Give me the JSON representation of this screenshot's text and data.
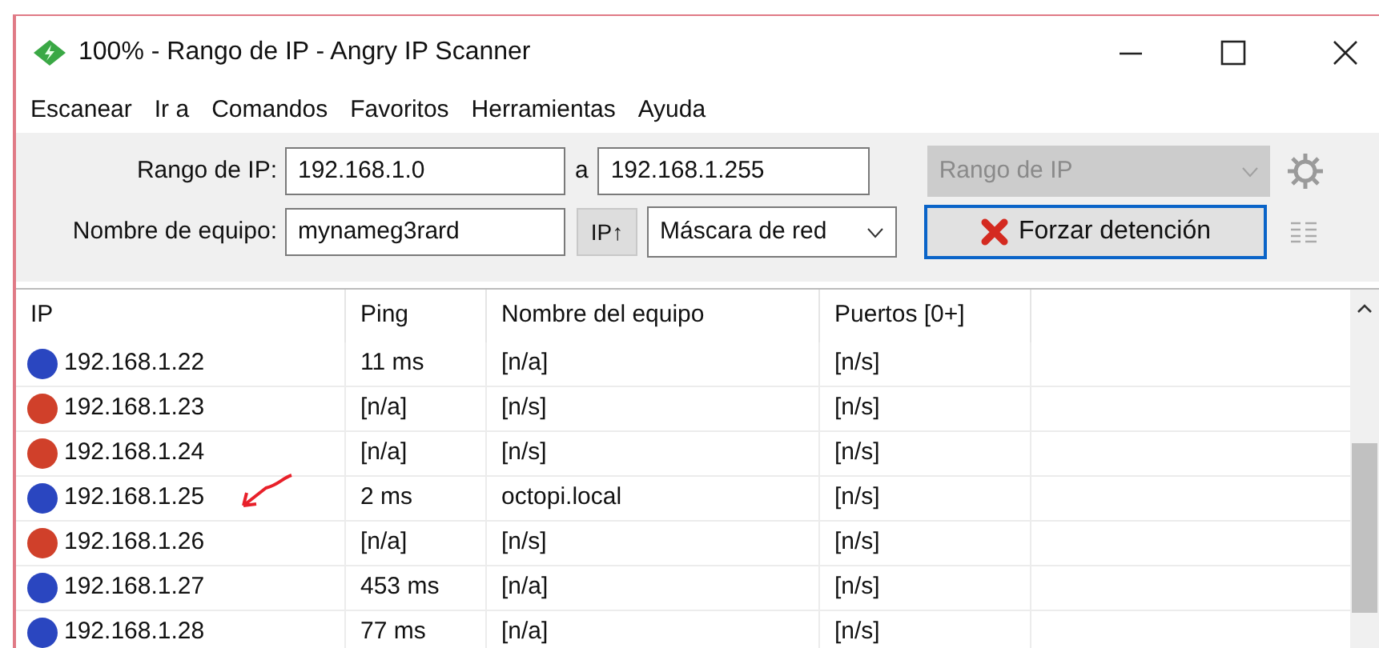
{
  "window": {
    "title": "100% - Rango de IP - Angry IP Scanner"
  },
  "menu": [
    "Escanear",
    "Ir a",
    "Comandos",
    "Favoritos",
    "Herramientas",
    "Ayuda"
  ],
  "toolbar": {
    "range_label": "Rango de IP:",
    "range_start": "192.168.1.0",
    "range_sep": "a",
    "range_end": "192.168.1.255",
    "feeder_select": {
      "value": "Rango de IP",
      "disabled": true
    },
    "host_label": "Nombre de equipo:",
    "host_value": "mynameg3rard",
    "ip_button": "IP↑",
    "netmask_select": "Máscara de red",
    "stop_button": "Forzar detención"
  },
  "table": {
    "columns": [
      "IP",
      "Ping",
      "Nombre del equipo",
      "Puertos [0+]"
    ],
    "rows": [
      {
        "color": "#2a46c0",
        "ip": "192.168.1.22",
        "ping": "11 ms",
        "hostname": "[n/a]",
        "ports": "[n/s]"
      },
      {
        "color": "#d0402a",
        "ip": "192.168.1.23",
        "ping": "[n/a]",
        "hostname": "[n/s]",
        "ports": "[n/s]"
      },
      {
        "color": "#d0402a",
        "ip": "192.168.1.24",
        "ping": "[n/a]",
        "hostname": "[n/s]",
        "ports": "[n/s]"
      },
      {
        "color": "#2a46c0",
        "ip": "192.168.1.25",
        "ping": "2 ms",
        "hostname": "octopi.local",
        "ports": "[n/s]",
        "annotated": true
      },
      {
        "color": "#d0402a",
        "ip": "192.168.1.26",
        "ping": "[n/a]",
        "hostname": "[n/s]",
        "ports": "[n/s]"
      },
      {
        "color": "#2a46c0",
        "ip": "192.168.1.27",
        "ping": "453 ms",
        "hostname": "[n/a]",
        "ports": "[n/s]"
      },
      {
        "color": "#2a46c0",
        "ip": "192.168.1.28",
        "ping": "77 ms",
        "hostname": "[n/a]",
        "ports": "[n/s]"
      }
    ]
  }
}
